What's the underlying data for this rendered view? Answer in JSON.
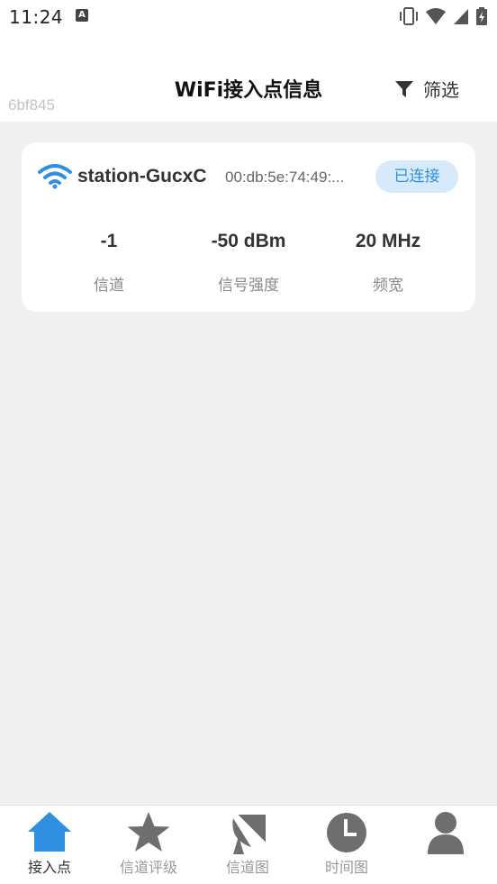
{
  "status_bar": {
    "time": "11:24",
    "notif_letter": "A"
  },
  "header": {
    "title": "WiFi接入点信息",
    "device_id": "6bf845",
    "filter_label": "筛选"
  },
  "access_points": [
    {
      "ssid": "station-GucxC",
      "bssid": "00:db:5e:74:49:...",
      "status": "已连接",
      "channel": "-1",
      "channel_label": "信道",
      "signal": "-50 dBm",
      "signal_label": "信号强度",
      "bandwidth": "20 MHz",
      "bandwidth_label": "频宽"
    }
  ],
  "bottom_nav": {
    "items": [
      {
        "label": "接入点",
        "icon": "home-icon",
        "active": true
      },
      {
        "label": "信道评级",
        "icon": "star-icon",
        "active": false
      },
      {
        "label": "信道图",
        "icon": "satellite-dish-icon",
        "active": false
      },
      {
        "label": "时间图",
        "icon": "clock-icon",
        "active": false
      },
      {
        "label": "",
        "icon": "person-icon",
        "active": false
      }
    ]
  },
  "colors": {
    "accent": "#2f8fe0",
    "inactive_icon": "#6e6e6e",
    "badge_bg": "#d6eafb"
  }
}
